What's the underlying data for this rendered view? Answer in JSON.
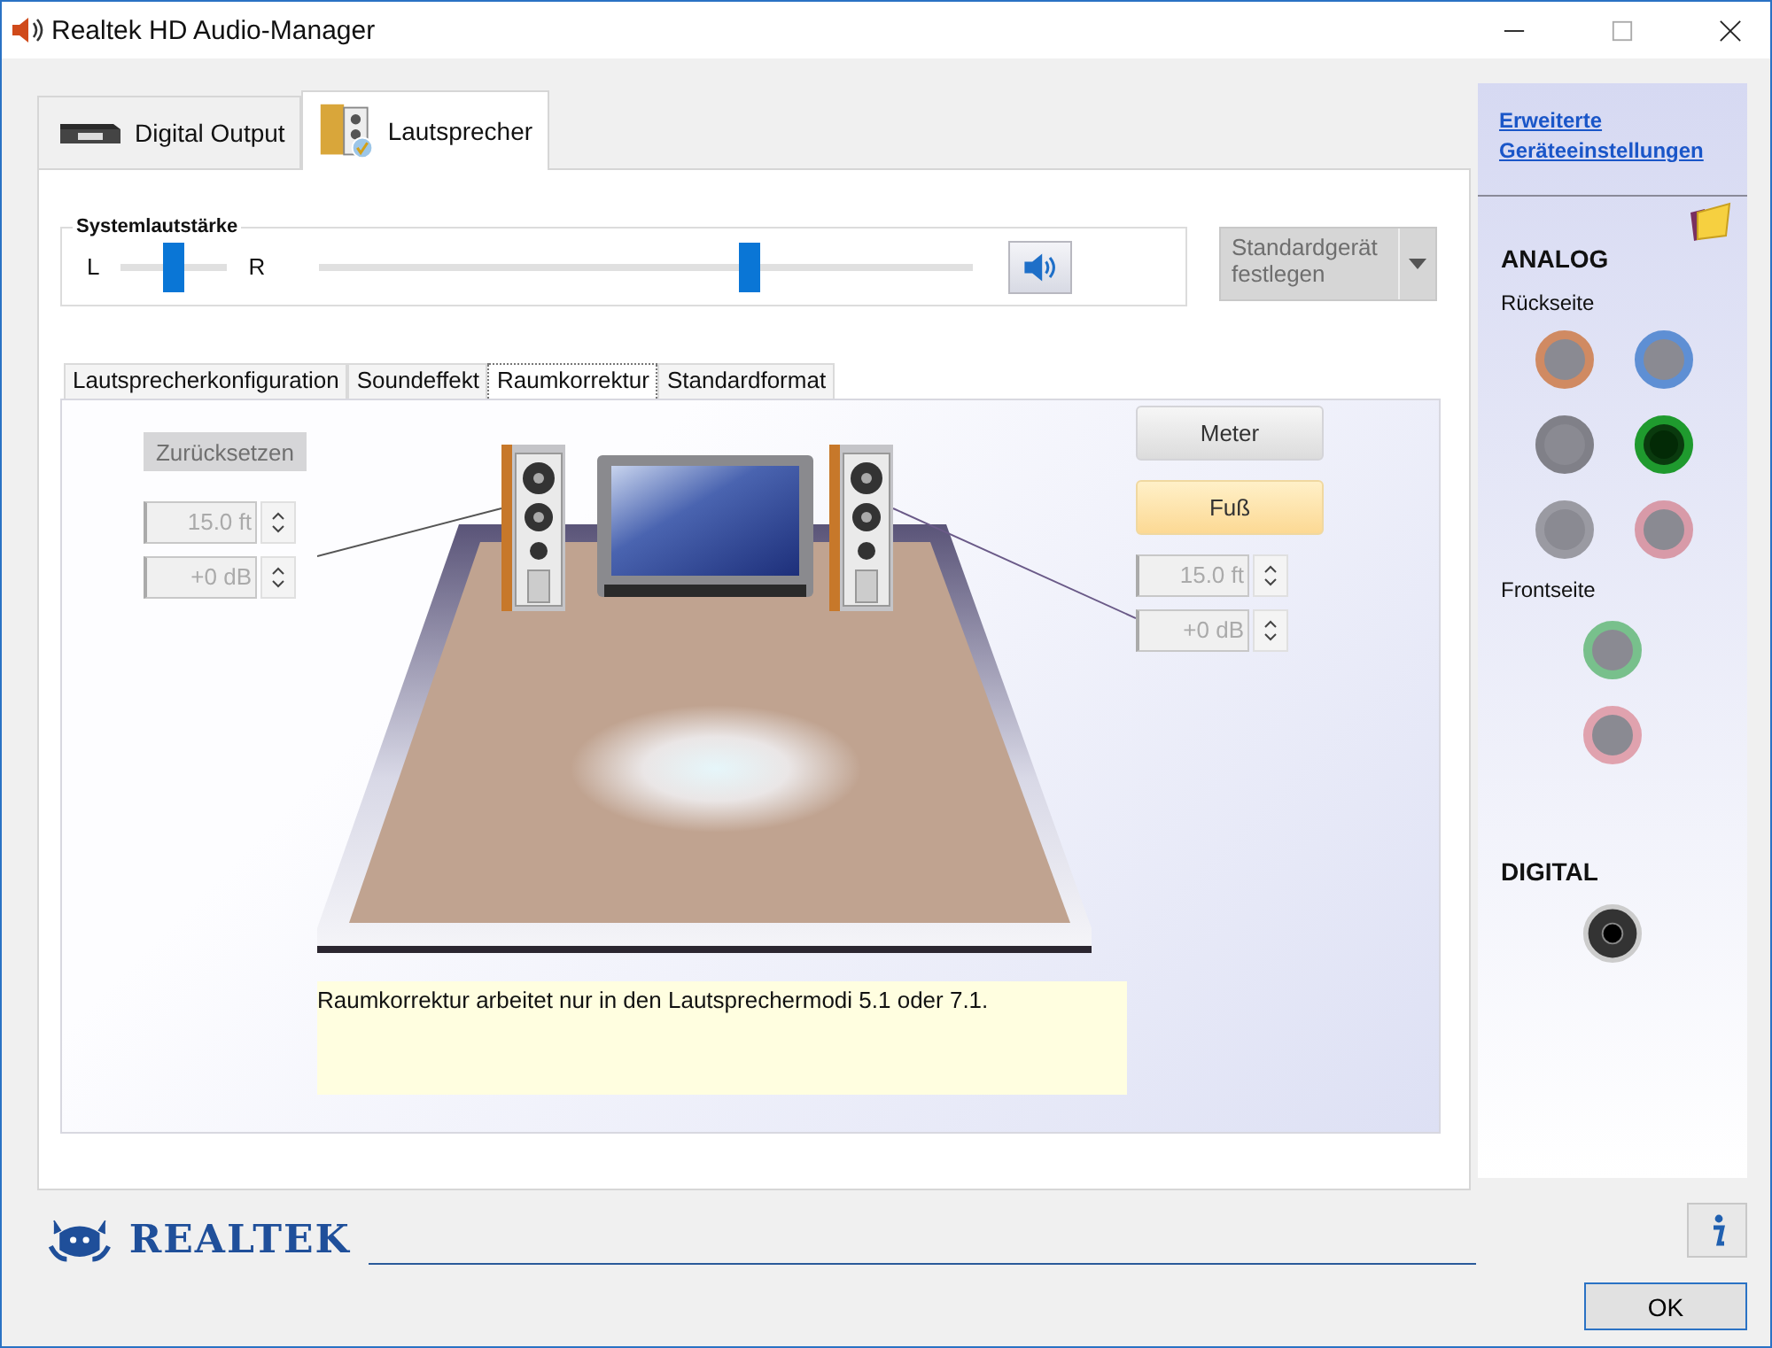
{
  "window": {
    "title": "Realtek HD Audio-Manager"
  },
  "device_tabs": [
    {
      "label": "Digital Output",
      "kind": "digital",
      "selected": false
    },
    {
      "label": "Lautsprecher",
      "kind": "speakers",
      "selected": true
    }
  ],
  "system_volume": {
    "label": "Systemlautstärke",
    "left_label": "L",
    "right_label": "R",
    "balance": {
      "level": 0.5
    },
    "volume": {
      "level": 0.66
    },
    "muted": false
  },
  "default_device_button": {
    "label": "Standardgerät festlegen",
    "disabled": true
  },
  "sub_tabs": [
    {
      "label": "Lautsprecherkonfiguration",
      "selected": false
    },
    {
      "label": "Soundeffekt",
      "selected": false
    },
    {
      "label": "Raumkorrektur",
      "selected": true
    },
    {
      "label": "Standardformat",
      "selected": false
    }
  ],
  "room_correction": {
    "reset_button": {
      "label": "Zurücksetzen",
      "disabled": true
    },
    "left": {
      "distance": "15.0 ft",
      "gain": "+0 dB"
    },
    "right": {
      "distance": "15.0 ft",
      "gain": "+0 dB"
    },
    "unit_buttons": [
      {
        "label": "Meter",
        "selected": false
      },
      {
        "label": "Fuß",
        "selected": true
      }
    ],
    "info_text": "Raumkorrektur arbeitet nur in den Lautsprechermodi 5.1 oder 7.1."
  },
  "side_panel": {
    "link": "Erweiterte Geräteeinstellungen",
    "analog_title": "ANALOG",
    "rear_label": "Rückseite",
    "rear_jacks": [
      {
        "color": "#d08a62",
        "active": false
      },
      {
        "color": "#5e8fd4",
        "active": false
      },
      {
        "color": "#808088",
        "active": false
      },
      {
        "color": "#1f9a2e",
        "active": true
      },
      {
        "color": "#9a9aa2",
        "active": false
      },
      {
        "color": "#d89aa8",
        "active": false
      }
    ],
    "front_label": "Frontseite",
    "front_jacks": [
      {
        "color": "#78c08c",
        "active": false
      },
      {
        "color": "#e0a2ae",
        "active": false
      }
    ],
    "digital_title": "DIGITAL"
  },
  "footer": {
    "brand": "REALTEK",
    "ok_button": "OK"
  }
}
